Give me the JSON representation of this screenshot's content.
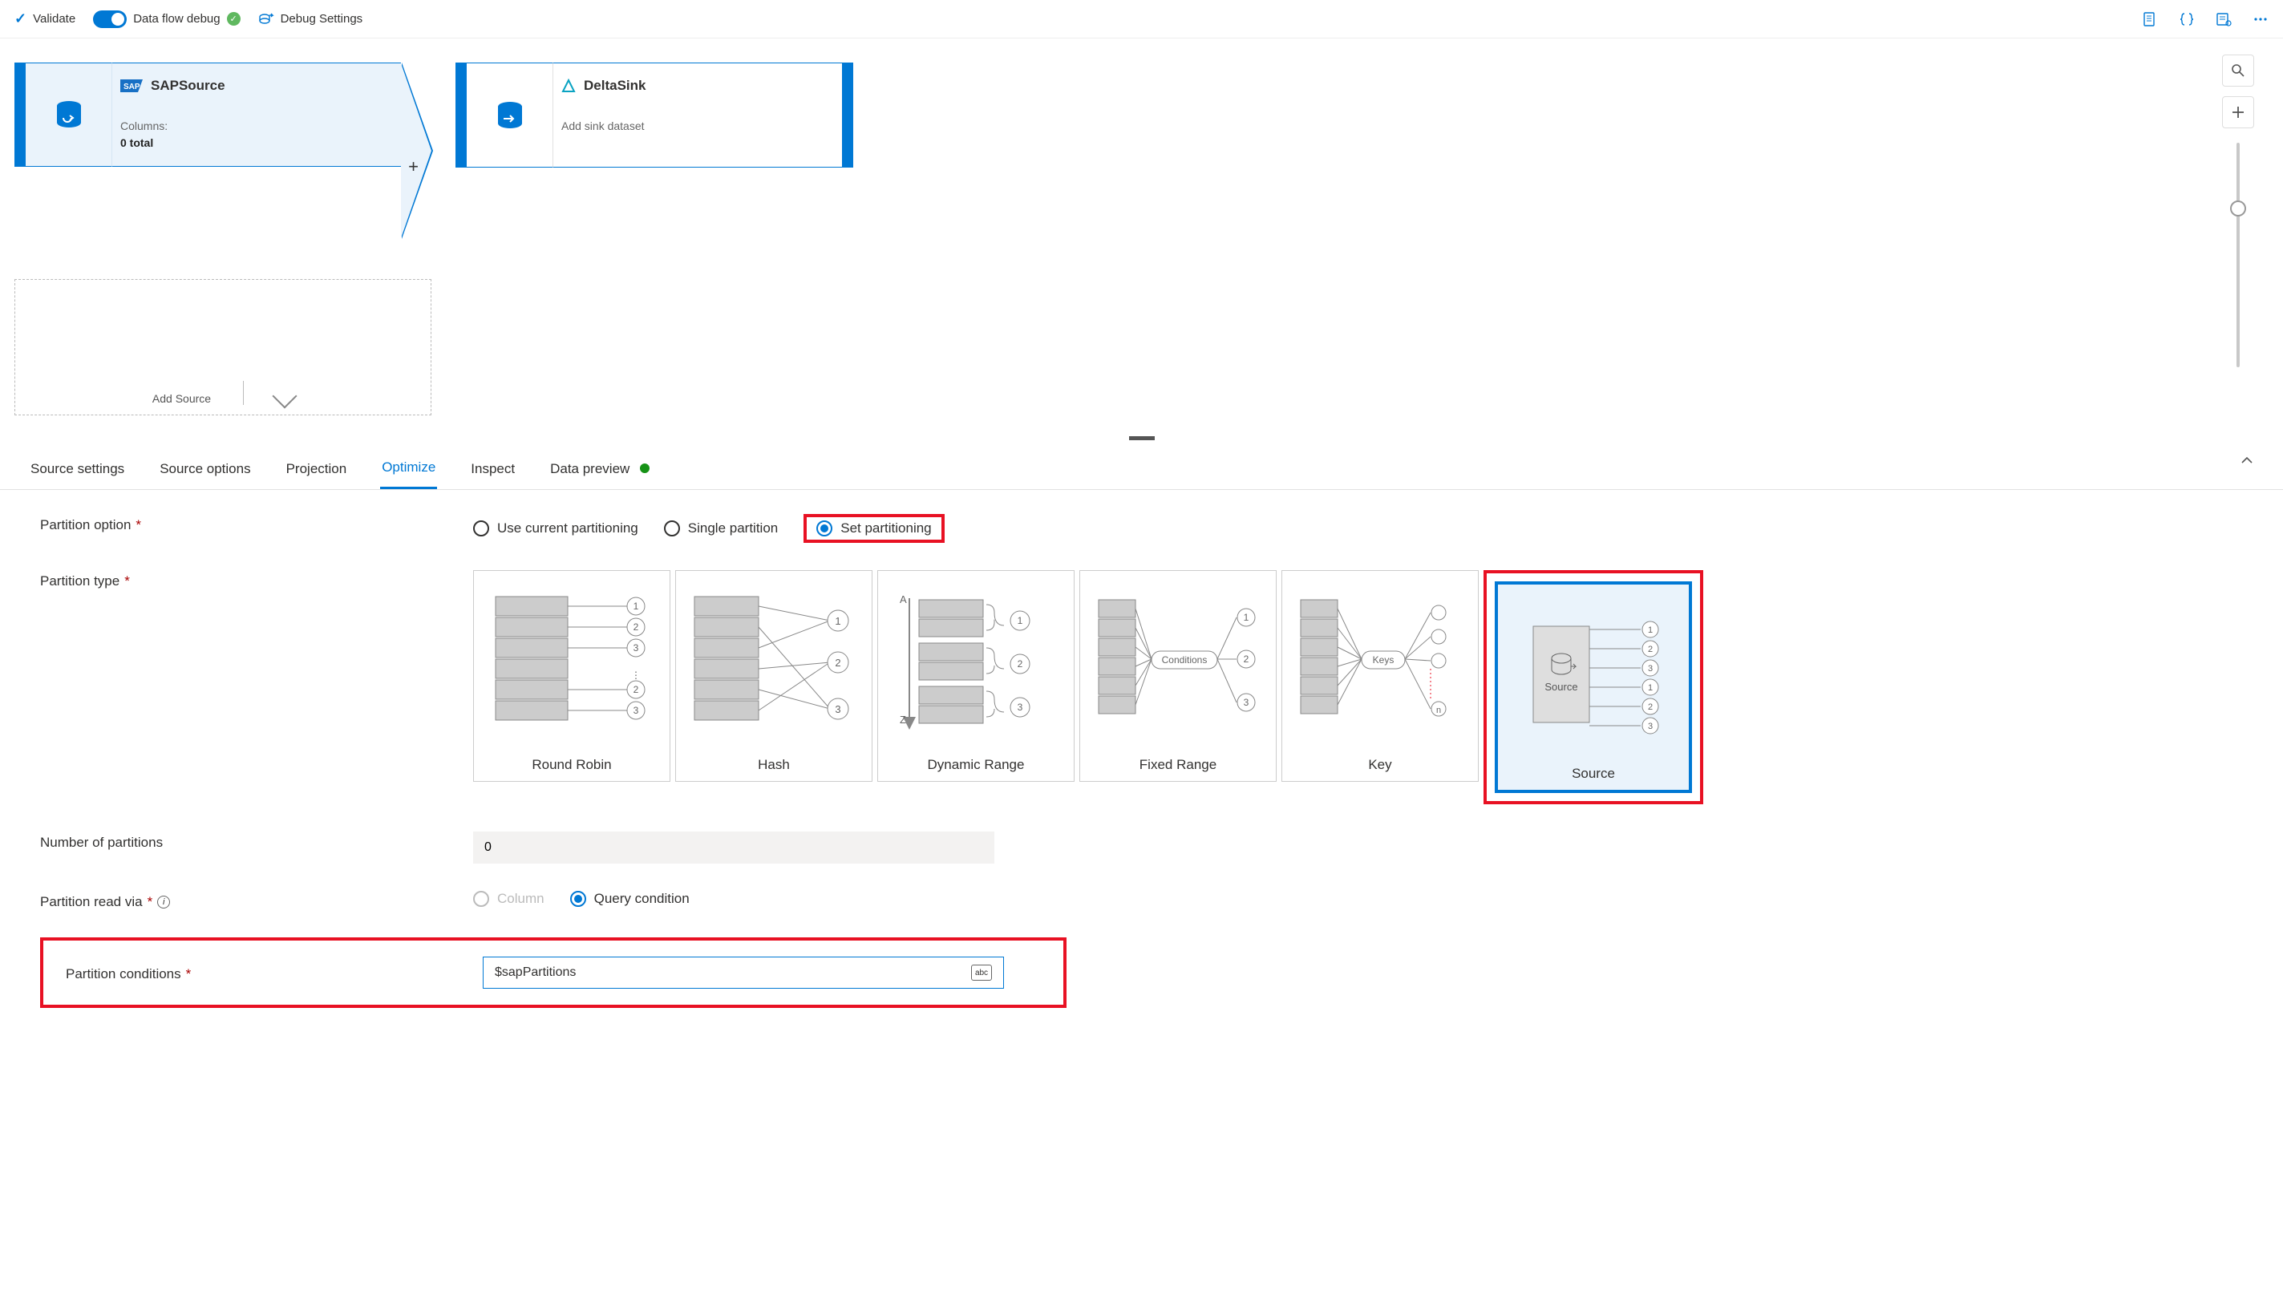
{
  "toolbar": {
    "validate": "Validate",
    "debug_label": "Data flow debug",
    "debug_settings": "Debug Settings"
  },
  "canvas": {
    "sap": {
      "title": "SAPSource",
      "columns_label": "Columns:",
      "columns_value": "0 total"
    },
    "sink": {
      "title": "DeltaSink",
      "subtitle": "Add sink dataset"
    },
    "add_source": "Add Source"
  },
  "tabs": {
    "source_settings": "Source settings",
    "source_options": "Source options",
    "projection": "Projection",
    "optimize": "Optimize",
    "inspect": "Inspect",
    "data_preview": "Data preview"
  },
  "form": {
    "partition_option_label": "Partition option",
    "opt_current": "Use current partitioning",
    "opt_single": "Single partition",
    "opt_set": "Set partitioning",
    "partition_type_label": "Partition type",
    "types": {
      "rr": "Round Robin",
      "hash": "Hash",
      "dr": "Dynamic Range",
      "fr": "Fixed Range",
      "key": "Key",
      "src": "Source"
    },
    "dr_conditions": "Conditions",
    "key_label": "Keys",
    "src_label": "Source",
    "num_partitions_label": "Number of partitions",
    "num_partitions_value": "0",
    "read_via_label": "Partition read via",
    "read_via_column": "Column",
    "read_via_query": "Query condition",
    "conditions_label": "Partition conditions",
    "conditions_value": "$sapPartitions",
    "abc": "abc"
  }
}
